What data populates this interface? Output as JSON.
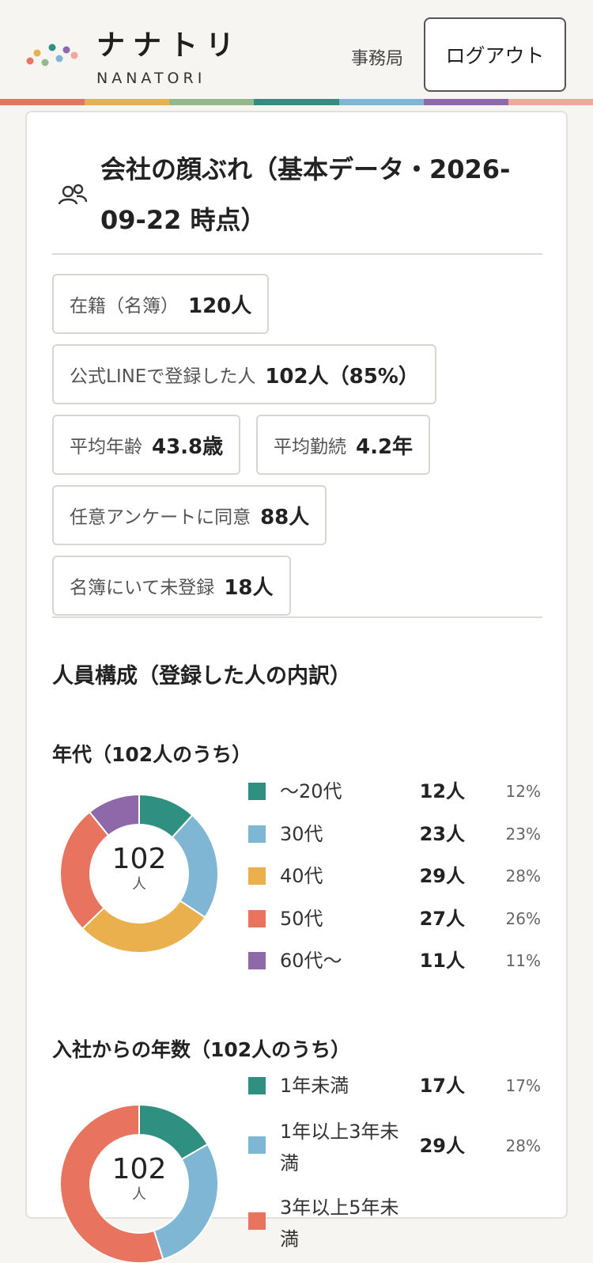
{
  "header": {
    "logo_title": "ナナトリ",
    "logo_sub": "NANATORI",
    "role": "事務局",
    "logout_label": "ログアウト"
  },
  "colors": {
    "stripe": [
      "#e8735f",
      "#e9b04d",
      "#95b98a",
      "#2f8f80",
      "#7fb6d4",
      "#8e68a8",
      "#f2a69c"
    ],
    "logo_dots": [
      "#e8735f",
      "#e9b04d",
      "#2f8f80",
      "#95b98a",
      "#8e68a8",
      "#7fb6d4",
      "#f2a69c"
    ]
  },
  "card": {
    "title": "会社の顔ぶれ（基本データ・2026-09-22 時点）",
    "stats": [
      {
        "label": "在籍（名簿）",
        "value": "120人"
      },
      {
        "label": "公式LINEで登録した人",
        "value": "102人（85%）"
      },
      {
        "label": "平均年齢",
        "value": "43.8歳"
      },
      {
        "label": "平均勤続",
        "value": "4.2年"
      },
      {
        "label": "任意アンケートに同意",
        "value": "88人"
      },
      {
        "label": "名簿にいて未登録",
        "value": "18人"
      }
    ],
    "composition_title": "人員構成（登録した人の内訳）"
  },
  "chart_data": [
    {
      "type": "pie",
      "title": "年代（102人のうち）",
      "center_value": "102",
      "center_unit": "人",
      "categories": [
        "〜20代",
        "30代",
        "40代",
        "50代",
        "60代〜"
      ],
      "counts": [
        "12人",
        "23人",
        "29人",
        "27人",
        "11人"
      ],
      "percents": [
        "12%",
        "23%",
        "28%",
        "26%",
        "11%"
      ],
      "values": [
        12,
        23,
        29,
        27,
        11
      ],
      "colors": [
        "#2f8f80",
        "#7fb6d4",
        "#e9b04d",
        "#e8735f",
        "#8e68a8"
      ]
    },
    {
      "type": "pie",
      "title": "入社からの年数（102人のうち）",
      "center_value": "102",
      "center_unit": "人",
      "categories": [
        "1年未満",
        "1年以上3年未満",
        "3年以上5年未満"
      ],
      "counts": [
        "17人",
        "29人",
        ""
      ],
      "percents": [
        "17%",
        "28%",
        ""
      ],
      "values": [
        17,
        29,
        56
      ],
      "colors": [
        "#2f8f80",
        "#7fb6d4",
        "#e8735f"
      ]
    }
  ]
}
